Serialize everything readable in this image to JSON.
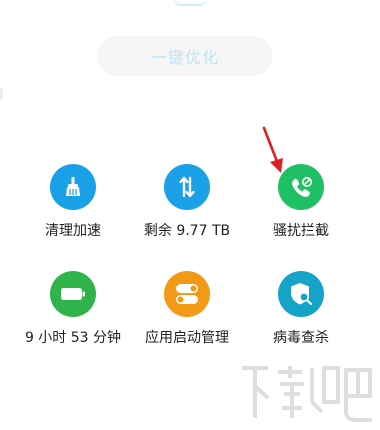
{
  "optimize_button": {
    "label": "一键优化"
  },
  "tiles": [
    {
      "label": "清理加速",
      "icon": "broom-icon",
      "color": "#1aa0e6"
    },
    {
      "label": "剩余 9.77 TB",
      "icon": "transfer-arrows-icon",
      "color": "#1aa0e6"
    },
    {
      "label": "骚扰拦截",
      "icon": "blocked-call-icon",
      "color": "#1fbf63"
    },
    {
      "label": "9 小时 53 分钟",
      "icon": "battery-icon",
      "color": "#2fb34a"
    },
    {
      "label": "应用启动管理",
      "icon": "toggle-switches-icon",
      "color": "#f29a16"
    },
    {
      "label": "病毒查杀",
      "icon": "shield-search-icon",
      "color": "#15a3c8"
    }
  ],
  "colors": {
    "accent_blue": "#1aa0e6",
    "arrow_red": "#e02020",
    "watermark_gray": "#d9d9d9"
  }
}
